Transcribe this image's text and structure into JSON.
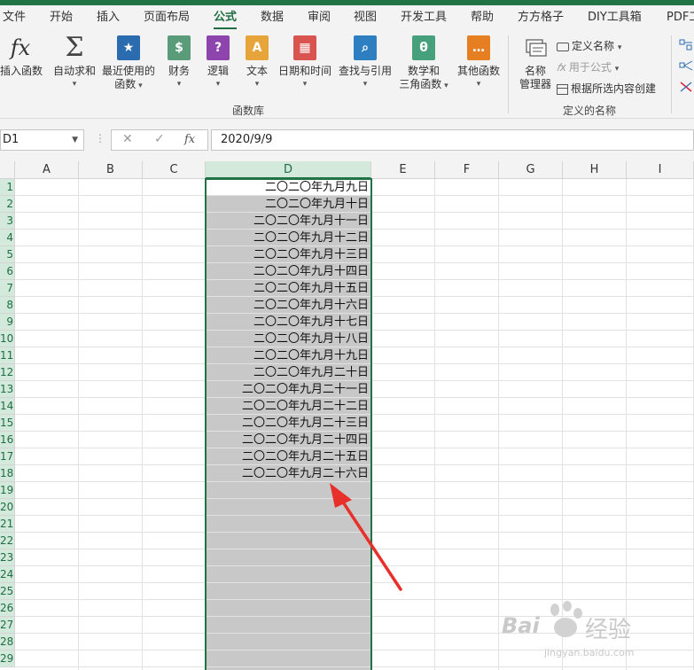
{
  "menu_tabs": [
    {
      "label": "文件",
      "active": false
    },
    {
      "label": "开始",
      "active": false
    },
    {
      "label": "插入",
      "active": false
    },
    {
      "label": "页面布局",
      "active": false
    },
    {
      "label": "公式",
      "active": true
    },
    {
      "label": "数据",
      "active": false
    },
    {
      "label": "审阅",
      "active": false
    },
    {
      "label": "视图",
      "active": false
    },
    {
      "label": "开发工具",
      "active": false
    },
    {
      "label": "帮助",
      "active": false
    },
    {
      "label": "方方格子",
      "active": false
    },
    {
      "label": "DIY工具箱",
      "active": false
    },
    {
      "label": "PDF工",
      "active": false
    }
  ],
  "ribbon": {
    "function_library": {
      "group_label": "函数库",
      "buttons": [
        {
          "label": "插入函数",
          "label2": "",
          "icon": "fx-icon"
        },
        {
          "label": "自动求和",
          "label2": "",
          "icon": "sigma-icon",
          "dropdown": true
        },
        {
          "label": "最近使用的",
          "label2": "函数",
          "icon": "star-book-icon",
          "dropdown": true
        },
        {
          "label": "财务",
          "label2": "",
          "icon": "money-book-icon",
          "dropdown": true
        },
        {
          "label": "逻辑",
          "label2": "",
          "icon": "question-book-icon",
          "dropdown": true
        },
        {
          "label": "文本",
          "label2": "",
          "icon": "text-book-icon",
          "dropdown": true
        },
        {
          "label": "日期和时间",
          "label2": "",
          "icon": "calendar-book-icon",
          "dropdown": true
        },
        {
          "label": "查找与引用",
          "label2": "",
          "icon": "magnifier-book-icon",
          "dropdown": true
        },
        {
          "label": "数学和",
          "label2": "三角函数",
          "icon": "theta-book-icon",
          "dropdown": true
        },
        {
          "label": "其他函数",
          "label2": "",
          "icon": "more-book-icon",
          "dropdown": true
        }
      ]
    },
    "defined_names": {
      "group_label": "定义的名称",
      "name_manager_label": "名称",
      "name_manager_label2": "管理器",
      "define_name": "定义名称",
      "use_in_formula": "用于公式",
      "create_from_selection": "根据所选内容创建"
    }
  },
  "formula_bar": {
    "name_box": "D1",
    "cancel_symbol": "✕",
    "enter_symbol": "✓",
    "fx_symbol": "fx",
    "formula": "2020/9/9"
  },
  "sheet": {
    "columns": [
      "A",
      "B",
      "C",
      "D",
      "E",
      "F",
      "G",
      "H",
      "I"
    ],
    "selected_column": "D",
    "rows": [
      {
        "num": "1",
        "d": "二〇二〇年九月九日"
      },
      {
        "num": "2",
        "d": "二〇二〇年九月十日"
      },
      {
        "num": "3",
        "d": "二〇二〇年九月十一日"
      },
      {
        "num": "4",
        "d": "二〇二〇年九月十二日"
      },
      {
        "num": "5",
        "d": "二〇二〇年九月十三日"
      },
      {
        "num": "6",
        "d": "二〇二〇年九月十四日"
      },
      {
        "num": "7",
        "d": "二〇二〇年九月十五日"
      },
      {
        "num": "8",
        "d": "二〇二〇年九月十六日"
      },
      {
        "num": "9",
        "d": "二〇二〇年九月十七日"
      },
      {
        "num": "10",
        "d": "二〇二〇年九月十八日"
      },
      {
        "num": "11",
        "d": "二〇二〇年九月十九日"
      },
      {
        "num": "12",
        "d": "二〇二〇年九月二十日"
      },
      {
        "num": "13",
        "d": "二〇二〇年九月二十一日"
      },
      {
        "num": "14",
        "d": "二〇二〇年九月二十二日"
      },
      {
        "num": "15",
        "d": "二〇二〇年九月二十三日"
      },
      {
        "num": "16",
        "d": "二〇二〇年九月二十四日"
      },
      {
        "num": "17",
        "d": "二〇二〇年九月二十五日"
      },
      {
        "num": "18",
        "d": "二〇二〇年九月二十六日"
      },
      {
        "num": "19",
        "d": ""
      },
      {
        "num": "20",
        "d": ""
      },
      {
        "num": "21",
        "d": ""
      },
      {
        "num": "22",
        "d": ""
      },
      {
        "num": "23",
        "d": ""
      },
      {
        "num": "24",
        "d": ""
      },
      {
        "num": "25",
        "d": ""
      },
      {
        "num": "26",
        "d": ""
      },
      {
        "num": "27",
        "d": ""
      },
      {
        "num": "28",
        "d": ""
      },
      {
        "num": "29",
        "d": ""
      }
    ]
  },
  "watermark": {
    "brand": "Bai",
    "brand2": "经验",
    "url": "jingyan.baidu.com"
  },
  "colors": {
    "accent": "#217346",
    "selection": "#c8c8c8",
    "arrow": "#e8302a"
  }
}
